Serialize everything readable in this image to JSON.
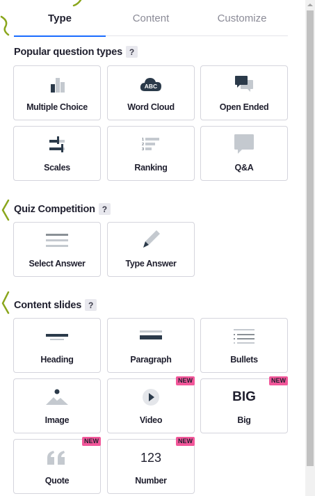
{
  "tabs": [
    {
      "label": "Type",
      "active": true
    },
    {
      "label": "Content",
      "active": false
    },
    {
      "label": "Customize",
      "active": false
    }
  ],
  "sections": {
    "popular": {
      "title": "Popular question types",
      "help": "?",
      "items": [
        {
          "label": "Multiple Choice",
          "icon": "bar-chart-icon"
        },
        {
          "label": "Word Cloud",
          "icon": "cloud-abc-icon",
          "icon_text": "ABC"
        },
        {
          "label": "Open Ended",
          "icon": "speech-bubbles-icon"
        },
        {
          "label": "Scales",
          "icon": "sliders-icon"
        },
        {
          "label": "Ranking",
          "icon": "ranked-list-icon",
          "icon_text": [
            "1",
            "2",
            "3"
          ]
        },
        {
          "label": "Q&A",
          "icon": "chat-bubble-icon"
        }
      ]
    },
    "quiz": {
      "title": "Quiz Competition",
      "help": "?",
      "items": [
        {
          "label": "Select Answer",
          "icon": "list-lines-icon"
        },
        {
          "label": "Type Answer",
          "icon": "pencil-icon"
        }
      ]
    },
    "content": {
      "title": "Content slides",
      "help": "?",
      "items": [
        {
          "label": "Heading",
          "icon": "heading-icon"
        },
        {
          "label": "Paragraph",
          "icon": "paragraph-icon"
        },
        {
          "label": "Bullets",
          "icon": "bullets-icon"
        },
        {
          "label": "Image",
          "icon": "image-icon"
        },
        {
          "label": "Video",
          "icon": "play-icon",
          "badge": "NEW"
        },
        {
          "label": "Big",
          "icon": "big-text-icon",
          "icon_text": "BIG",
          "badge": "NEW"
        },
        {
          "label": "Quote",
          "icon": "quote-icon",
          "badge": "NEW"
        },
        {
          "label": "Number",
          "icon": "number-icon",
          "icon_text": "123",
          "badge": "NEW"
        }
      ]
    }
  },
  "colors": {
    "accent": "#196cff",
    "badge": "#f2579a",
    "icon_dark": "#2b3a4a",
    "icon_light": "#c4c9cf",
    "decor_green": "#8aa61c"
  }
}
